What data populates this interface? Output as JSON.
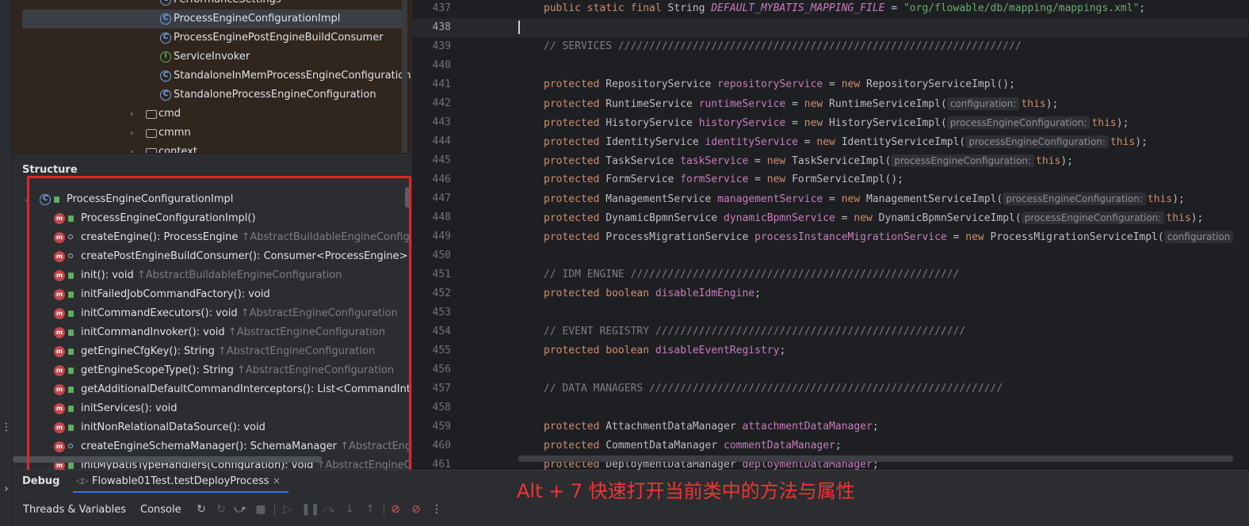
{
  "project_tree": {
    "rows": [
      {
        "label": "PerformanceSettings",
        "kind": "class"
      },
      {
        "label": "ProcessEngineConfigurationImpl",
        "kind": "class",
        "selected": true
      },
      {
        "label": "ProcessEnginePostEngineBuildConsumer",
        "kind": "class"
      },
      {
        "label": "ServiceInvoker",
        "kind": "interface"
      },
      {
        "label": "StandaloneInMemProcessEngineConfiguration",
        "kind": "class"
      },
      {
        "label": "StandaloneProcessEngineConfiguration",
        "kind": "class"
      },
      {
        "label": "cmd",
        "kind": "folder"
      },
      {
        "label": "cmmn",
        "kind": "folder"
      },
      {
        "label": "context",
        "kind": "folder"
      }
    ]
  },
  "structure": {
    "title": "Structure",
    "root": "ProcessEngineConfigurationImpl",
    "items": [
      {
        "name": "ProcessEngineConfigurationImpl()",
        "super": "",
        "vis": "pub"
      },
      {
        "name": "createEngine(): ProcessEngine",
        "super": "↑AbstractBuildableEngineConfigur",
        "vis": "prot"
      },
      {
        "name": "createPostEngineBuildConsumer(): Consumer<ProcessEngine>",
        "super": "↑A",
        "vis": "prot"
      },
      {
        "name": "init(): void",
        "super": "↑AbstractBuildableEngineConfiguration",
        "vis": "pub"
      },
      {
        "name": "initFailedJobCommandFactory(): void",
        "super": "",
        "vis": "pub"
      },
      {
        "name": "initCommandExecutors(): void",
        "super": "↑AbstractEngineConfiguration",
        "vis": "pub"
      },
      {
        "name": "initCommandInvoker(): void",
        "super": "↑AbstractEngineConfiguration",
        "vis": "pub"
      },
      {
        "name": "getEngineCfgKey(): String",
        "super": "↑AbstractEngineConfiguration",
        "vis": "pub"
      },
      {
        "name": "getEngineScopeType(): String",
        "super": "↑AbstractEngineConfiguration",
        "vis": "pub"
      },
      {
        "name": "getAdditionalDefaultCommandInterceptors(): List<CommandIntercep",
        "super": "",
        "vis": "pub"
      },
      {
        "name": "initServices(): void",
        "super": "",
        "vis": "pub"
      },
      {
        "name": "initNonRelationalDataSource(): void",
        "super": "",
        "vis": "pub"
      },
      {
        "name": "createEngineSchemaManager(): SchemaManager",
        "super": "↑AbstractEngine",
        "vis": "prot"
      },
      {
        "name": "initMybatisTypeHandlers(Configuration): void",
        "super": "↑AbstractEngineCo",
        "vis": "pub"
      }
    ]
  },
  "editor": {
    "lines": [
      {
        "n": "437",
        "code": "<span class=\"kw\">public static final</span> String <span class=\"cst\">DEFAULT_MYBATIS_MAPPING_FILE</span> = <span class=\"str\">\"org/flowable/db/mapping/mappings.xml\"</span>;"
      },
      {
        "n": "438",
        "code": "",
        "caret": true
      },
      {
        "n": "439",
        "code": "<span class=\"cmt\">// SERVICES /////////////////////////////////////////////////////////////////</span>"
      },
      {
        "n": "440",
        "code": ""
      },
      {
        "n": "441",
        "code": "<span class=\"kw\">protected</span> RepositoryService <span class=\"fld\">repositoryService</span> = <span class=\"kw\">new</span> RepositoryServiceImpl();"
      },
      {
        "n": "442",
        "code": "<span class=\"kw\">protected</span> RuntimeService <span class=\"fld\">runtimeService</span> = <span class=\"kw\">new</span> RuntimeServiceImpl(<span class=\"hint\">configuration:</span><span class=\"kw\">this</span>);"
      },
      {
        "n": "443",
        "code": "<span class=\"kw\">protected</span> HistoryService <span class=\"fld\">historyService</span> = <span class=\"kw\">new</span> HistoryServiceImpl(<span class=\"hint\">processEngineConfiguration:</span><span class=\"kw\">this</span>);"
      },
      {
        "n": "444",
        "code": "<span class=\"kw\">protected</span> IdentityService <span class=\"fld\">identityService</span> = <span class=\"kw\">new</span> IdentityServiceImpl(<span class=\"hint\">processEngineConfiguration:</span><span class=\"kw\">this</span>);"
      },
      {
        "n": "445",
        "code": "<span class=\"kw\">protected</span> TaskService <span class=\"fld\">taskService</span> = <span class=\"kw\">new</span> TaskServiceImpl(<span class=\"hint\">processEngineConfiguration:</span><span class=\"kw\">this</span>);"
      },
      {
        "n": "446",
        "code": "<span class=\"kw\">protected</span> FormService <span class=\"fld\">formService</span> = <span class=\"kw\">new</span> FormServiceImpl();"
      },
      {
        "n": "447",
        "code": "<span class=\"kw\">protected</span> ManagementService <span class=\"fld\">managementService</span> = <span class=\"kw\">new</span> ManagementServiceImpl(<span class=\"hint\">processEngineConfiguration:</span><span class=\"kw\">this</span>);"
      },
      {
        "n": "448",
        "code": "<span class=\"kw\">protected</span> DynamicBpmnService <span class=\"fld\">dynamicBpmnService</span> = <span class=\"kw\">new</span> DynamicBpmnServiceImpl(<span class=\"hint\">processEngineConfiguration:</span><span class=\"kw\">this</span>);"
      },
      {
        "n": "449",
        "code": "<span class=\"kw\">protected</span> ProcessMigrationService <span class=\"fld\">processInstanceMigrationService</span> = <span class=\"kw\">new</span> ProcessMigrationServiceImpl(<span class=\"hint\">configuration</span>"
      },
      {
        "n": "450",
        "code": ""
      },
      {
        "n": "451",
        "code": "<span class=\"cmt\">// IDM ENGINE /////////////////////////////////////////////////////</span>"
      },
      {
        "n": "452",
        "code": "<span class=\"kw\">protected boolean</span> <span class=\"fld\">disableIdmEngine</span>;"
      },
      {
        "n": "453",
        "code": ""
      },
      {
        "n": "454",
        "code": "<span class=\"cmt\">// EVENT REGISTRY //////////////////////////////////////////////////</span>"
      },
      {
        "n": "455",
        "code": "<span class=\"kw\">protected boolean</span> <span class=\"fld\">disableEventRegistry</span>;"
      },
      {
        "n": "456",
        "code": ""
      },
      {
        "n": "457",
        "code": "<span class=\"cmt\">// DATA MANAGERS /////////////////////////////////////////////////////////</span>"
      },
      {
        "n": "458",
        "code": ""
      },
      {
        "n": "459",
        "code": "<span class=\"kw\">protected</span> AttachmentDataManager <span class=\"fld\">attachmentDataManager</span>;"
      },
      {
        "n": "460",
        "code": "<span class=\"kw\">protected</span> CommentDataManager <span class=\"fld\">commentDataManager</span>;"
      },
      {
        "n": "461",
        "code": "<span class=\"kw\">protected</span> DeploymentDataManager <span class=\"fld\">deploymentDataManager</span>;"
      }
    ]
  },
  "debug": {
    "label": "Debug",
    "run_tab": "Flowable01Test.testDeployProcess",
    "close": "×",
    "tabs": [
      "Threads & Variables",
      "Console"
    ]
  },
  "annotation": "Alt + 7 快速打开当前类中的方法与属性"
}
